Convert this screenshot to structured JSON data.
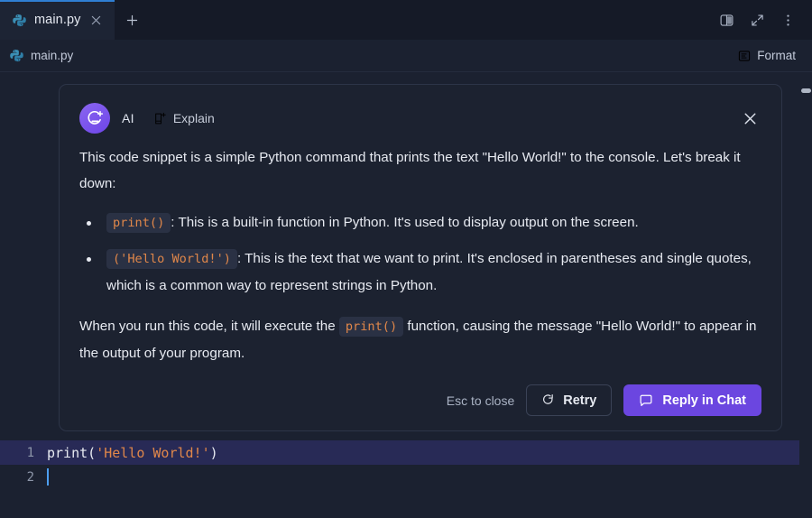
{
  "window": {
    "background": "#1b2130"
  },
  "tabbar": {
    "tabs": [
      {
        "label": "main.py",
        "icon": "python-icon",
        "active": true,
        "close_icon": "close-icon"
      }
    ],
    "new_tab_label": "+",
    "actions": [
      {
        "name": "split-panel-icon"
      },
      {
        "name": "expand-arrows-icon"
      },
      {
        "name": "more-options-icon"
      }
    ]
  },
  "breadcrumb": {
    "path": "main.py",
    "icon": "python-icon",
    "format_label": "Format",
    "format_icon": "format-icon"
  },
  "ai_panel": {
    "avatar_icon": "ai-sparkle-icon",
    "name": "AI",
    "explain_label": "Explain",
    "explain_icon": "explain-icon",
    "close_icon": "close-icon",
    "paragraph1": "This code snippet is a simple Python command that prints the text \"Hello World!\" to the console. Let's break it down:",
    "bullets": [
      {
        "code": "print()",
        "text": ": This is a built-in function in Python. It's used to display output on the screen."
      },
      {
        "code": "('Hello World!')",
        "text": ": This is the text that we want to print. It's enclosed in parentheses and single quotes, which is a common way to represent strings in Python."
      }
    ],
    "paragraph2_pre": "When you run this code, it will execute the ",
    "paragraph2_code": "print()",
    "paragraph2_post": " function, causing the message \"Hello World!\" to appear in the output of your program.",
    "footer": {
      "esc_hint": "Esc to close",
      "retry_label": "Retry",
      "retry_icon": "refresh-icon",
      "reply_label": "Reply in Chat",
      "reply_icon": "chat-bubble-icon",
      "reply_color": "#6b46e0"
    }
  },
  "editor": {
    "lines": [
      {
        "number": "1",
        "highlighted": true,
        "tokens": [
          {
            "text": "print(",
            "type": "plain"
          },
          {
            "text": "'Hello World!'",
            "type": "string"
          },
          {
            "text": ")",
            "type": "plain"
          }
        ]
      },
      {
        "number": "2",
        "highlighted": false,
        "tokens": [],
        "caret": true
      }
    ],
    "string_color": "#e0874a",
    "highlight_color": "#282a56",
    "caret_color": "#4d9ef0"
  },
  "scrollbar": {
    "name": "vertical-scrollbar"
  }
}
